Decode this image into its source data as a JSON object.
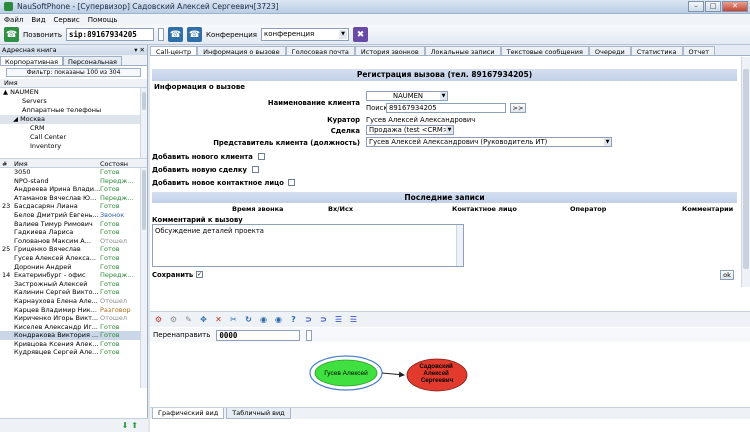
{
  "window": {
    "title": "NauSoftPhone - [Супервизор] Садовский Алексей Сергеевич[3723]"
  },
  "menu": [
    "Файл",
    "Вид",
    "Сервис",
    "Помощь"
  ],
  "toolbar": {
    "call_label": "Позвонить",
    "number_value": "sip:89167934205",
    "conference_label": "Конференция",
    "conference_value": "конференция"
  },
  "left": {
    "panel_title": "Адресная книга",
    "tabs": [
      "Корпоративная",
      "Персональная"
    ],
    "filter_text": "Фильтр: показаны 100 из 304",
    "tree_header": "Имя",
    "tree": [
      "NAUMEN",
      "Servers",
      "Аппаратные телефоны",
      "Москва",
      "CRM",
      "Call Center",
      "Inventory"
    ],
    "contacts_header": {
      "num": "#",
      "name": "Имя",
      "status": "Состоян"
    },
    "contacts": [
      {
        "num": "",
        "name": "3050",
        "status": "Готов",
        "kind": "ready"
      },
      {
        "num": "",
        "name": "NPO-stand",
        "status": "Передж...",
        "kind": "ready"
      },
      {
        "num": "",
        "name": "Андреева Ирина Влади...",
        "status": "Готов",
        "kind": "ready"
      },
      {
        "num": "",
        "name": "Атаманов Вячеслав Ю...",
        "status": "Передж...",
        "kind": "ready"
      },
      {
        "num": "23",
        "name": "Басдасарян Лиана",
        "status": "Готов",
        "kind": "ready"
      },
      {
        "num": "",
        "name": "Белов Дмитрий Евгень...",
        "status": "Звонок",
        "kind": "busy"
      },
      {
        "num": "",
        "name": "Валиев Тимур Римович",
        "status": "Готов",
        "kind": "ready"
      },
      {
        "num": "",
        "name": "Гадкиева Лариса",
        "status": "Готов",
        "kind": "ready"
      },
      {
        "num": "",
        "name": "Голованов Максим А...",
        "status": "Отошел",
        "kind": "gone"
      },
      {
        "num": "25",
        "name": "Гриценко Вячеслав",
        "status": "Готов",
        "kind": "ready"
      },
      {
        "num": "",
        "name": "Гусев Алексей Алекса...",
        "status": "Готов",
        "kind": "ready"
      },
      {
        "num": "",
        "name": "Доронин Андрей",
        "status": "Готов",
        "kind": "ready"
      },
      {
        "num": "14",
        "name": "Екатеринбург - офис",
        "status": "Передж...",
        "kind": "ready"
      },
      {
        "num": "",
        "name": "Застрожный Алексей",
        "status": "Готов",
        "kind": "ready"
      },
      {
        "num": "",
        "name": "Калинин Сергей Викто...",
        "status": "Готов",
        "kind": "ready"
      },
      {
        "num": "",
        "name": "Карнаухова Елена Але...",
        "status": "Отошел",
        "kind": "gone"
      },
      {
        "num": "",
        "name": "Карцев Владимир Ник...",
        "status": "Разговор",
        "kind": "talk"
      },
      {
        "num": "",
        "name": "Кириченко Игорь Викт...",
        "status": "Отошел",
        "kind": "gone"
      },
      {
        "num": "",
        "name": "Киселев Александр Иг...",
        "status": "Готов",
        "kind": "ready"
      },
      {
        "num": "",
        "name": "Кондракова Виктория ...",
        "status": "Готов",
        "kind": "ready",
        "selected": true
      },
      {
        "num": "",
        "name": "Кривцова Ксения Алек...",
        "status": "Готов",
        "kind": "ready"
      },
      {
        "num": "",
        "name": "Кудрявцев Сергей Але...",
        "status": "Готов",
        "kind": "ready"
      }
    ]
  },
  "tabs": [
    "Call-центр",
    "Информация о вызове",
    "Голосовая почта",
    "История звонков",
    "Локальные записи",
    "Текстовые сообщения",
    "Очереди",
    "Статистика",
    "Отчет"
  ],
  "registration": {
    "title": "Регистрация вызова (тел. 89167934205)",
    "section": "Информация о вызове",
    "client_label": "Наименование клиента",
    "client_value": "NAUMEN",
    "search_label": "Поиск",
    "search_value": "89167934205",
    "search_btn": ">>",
    "curator_label": "Куратор",
    "curator_value": "Гусев Алексей Александрович",
    "deal_label": "Сделка",
    "deal_value": "Продажа (test <CRM>",
    "rep_label": "Представитель клиента (должность)",
    "rep_value": "Гусев Алексей Александрович (Руководитель ИТ)",
    "add_client": "Добавить нового клиента",
    "add_deal": "Добавить новую сделку",
    "add_contact": "Добавить новое контактное лицо"
  },
  "recent": {
    "title": "Последние записи",
    "columns": [
      "Время звонка",
      "Вх/Исх",
      "Контактное лицо",
      "Оператор",
      "Комментарии"
    ],
    "comment_label": "Комментарий к вызову",
    "comment_value": "Обсуждение деталей проекта",
    "save_label": "Сохранить",
    "ok_label": "ok"
  },
  "redirect": {
    "label": "Перенаправить",
    "value": "0000"
  },
  "graph": {
    "node_a": "Гусев Алексей",
    "node_b": "Садовский Алексей Сергеевич"
  },
  "bottom_tabs": [
    "Графический вид",
    "Табличный вид"
  ],
  "colors": {
    "node_a": "#3fe03f",
    "node_b": "#e23b2e",
    "accent": "#c2d0e8"
  }
}
